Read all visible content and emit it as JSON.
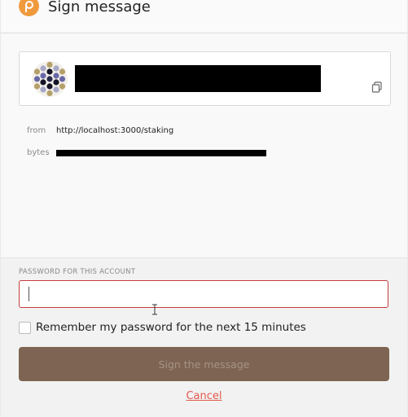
{
  "header": {
    "title": "Sign message"
  },
  "account": {},
  "details": {
    "from_label": "from",
    "from_value": "http://localhost:3000/staking",
    "bytes_label": "bytes"
  },
  "footer": {
    "password_label": "PASSWORD FOR THIS ACCOUNT",
    "password_value": "",
    "remember_label": "Remember my password for the next 15 minutes",
    "remember_checked": false,
    "sign_button_label": "Sign the message",
    "cancel_label": "Cancel"
  },
  "colors": {
    "accent": "#7e6453",
    "error": "#c73c3c",
    "link": "#e2584c",
    "logo": "#f09a3e"
  }
}
